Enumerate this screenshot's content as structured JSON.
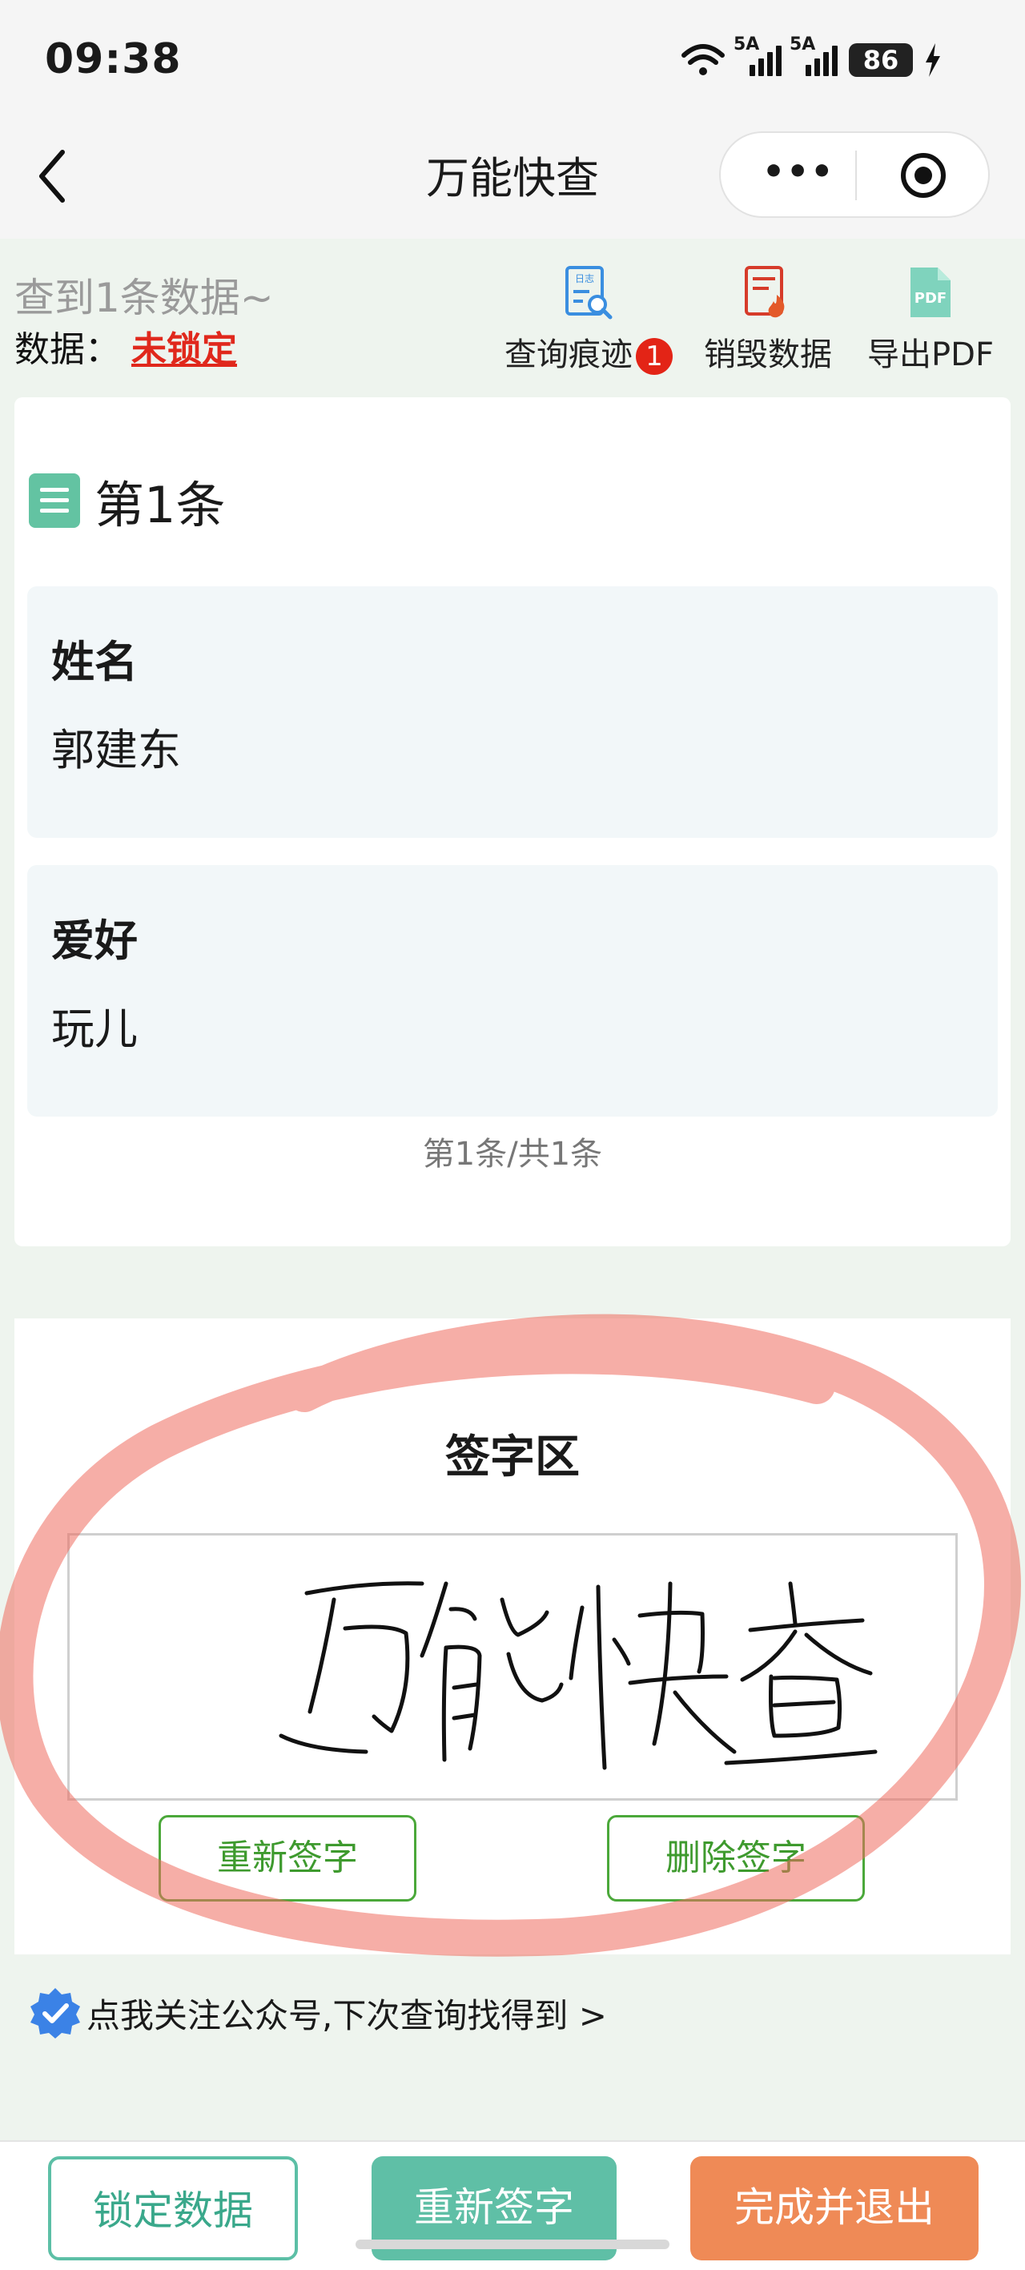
{
  "status_bar": {
    "time": "09:38",
    "net1": "5A",
    "net2": "5A",
    "battery": "86"
  },
  "nav": {
    "title": "万能快查",
    "more": "•••"
  },
  "summary": {
    "found_text": "查到1条数据~",
    "data_label": "数据：",
    "lock_status": "未锁定"
  },
  "toolbar": {
    "trace": {
      "label": "查询痕迹",
      "badge": "1",
      "icon_text": "日志"
    },
    "destroy": {
      "label": "销毁数据"
    },
    "export": {
      "label": "导出PDF",
      "icon_text": "PDF"
    }
  },
  "record": {
    "title": "第1条",
    "fields": [
      {
        "key": "姓名",
        "value": "郭建东"
      },
      {
        "key": "爱好",
        "value": "玩儿"
      }
    ],
    "pager": "第1条/共1条"
  },
  "signature": {
    "title": "签字区",
    "handwritten": "万能快查",
    "resign_label": "重新签字",
    "delete_label": "删除签字"
  },
  "follow": {
    "text": "点我关注公众号,下次查询找得到 >"
  },
  "bottom": {
    "lock": "锁定数据",
    "resign": "重新签字",
    "finish": "完成并退出"
  },
  "colors": {
    "accent": "#5fbfa6",
    "warn": "#e32416",
    "orange": "#ef8a56",
    "green": "#4ba83a"
  }
}
